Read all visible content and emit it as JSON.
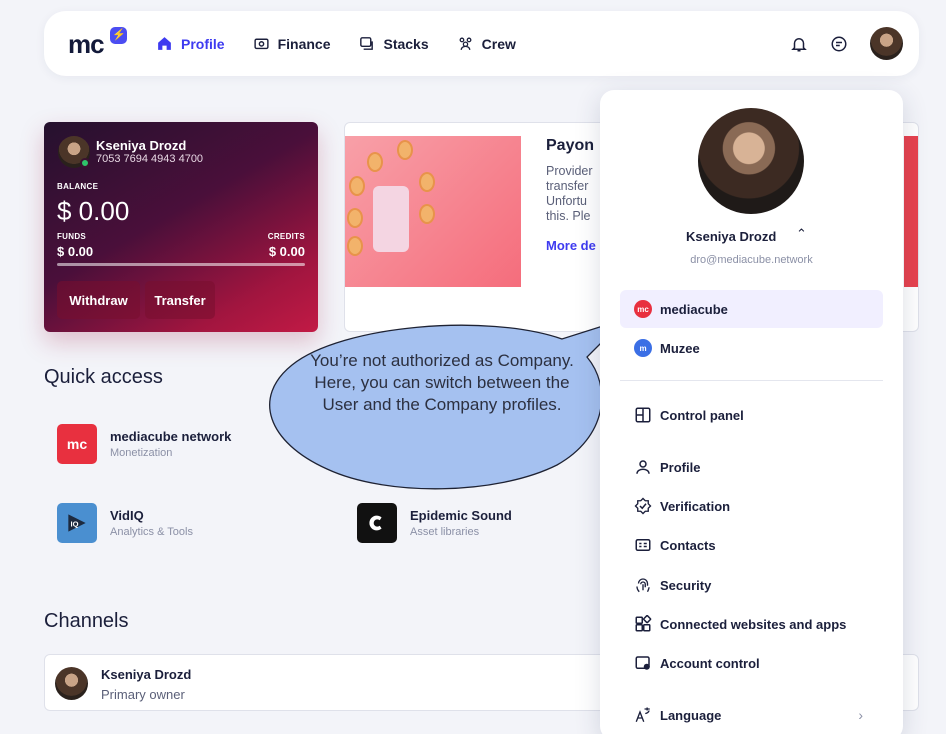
{
  "header": {
    "logo": "mc",
    "nav": [
      {
        "label": "Profile",
        "icon": "home-icon",
        "active": true
      },
      {
        "label": "Finance",
        "icon": "wallet-icon"
      },
      {
        "label": "Stacks",
        "icon": "stacks-icon"
      },
      {
        "label": "Crew",
        "icon": "crew-icon"
      }
    ]
  },
  "balance_card": {
    "name": "Kseniya Drozd",
    "card_number": "7053 7694 4943 4700",
    "balance_label": "BALANCE",
    "balance": "$ 0.00",
    "funds_label": "FUNDS",
    "funds": "$ 0.00",
    "credits_label": "CREDITS",
    "credits": "$ 0.00",
    "withdraw": "Withdraw",
    "transfer": "Transfer"
  },
  "promo": {
    "title": "Payon",
    "lines": [
      "Provider",
      "transfer",
      "Unfortu",
      "this. Ple"
    ],
    "more": "More de"
  },
  "quick_access": {
    "title": "Quick access",
    "items": [
      {
        "title": "mediacube network",
        "subtitle": "Monetization"
      },
      {
        "title": "VidIQ",
        "subtitle": "Analytics & Tools"
      },
      {
        "title": "Epidemic Sound",
        "subtitle": "Asset libraries"
      }
    ]
  },
  "channels": {
    "title": "Channels",
    "name": "Kseniya Drozd",
    "role": "Primary owner"
  },
  "tooltip": "You’re not authorized as Company. Here, you can switch between the User and the Company profiles.",
  "dropdown": {
    "name": "Kseniya Drozd",
    "email": "dro@mediacube.network",
    "orgs": [
      {
        "label": "mediacube",
        "badge": "mc",
        "color": "#e8303f"
      },
      {
        "label": "Muzee",
        "badge": "m",
        "color": "#3b6fe5"
      }
    ],
    "items": [
      {
        "label": "Control panel",
        "icon": "panel-icon"
      },
      {
        "label": "Profile",
        "icon": "user-icon"
      },
      {
        "label": "Verification",
        "icon": "verified-icon"
      },
      {
        "label": "Contacts",
        "icon": "contacts-icon"
      },
      {
        "label": "Security",
        "icon": "fingerprint-icon"
      },
      {
        "label": "Connected websites and apps",
        "icon": "apps-icon"
      },
      {
        "label": "Account control",
        "icon": "account-control-icon"
      },
      {
        "label": "Language",
        "icon": "language-icon"
      }
    ]
  },
  "colors": {
    "accent": "#3e3bf0",
    "brand_red": "#e8303f"
  }
}
